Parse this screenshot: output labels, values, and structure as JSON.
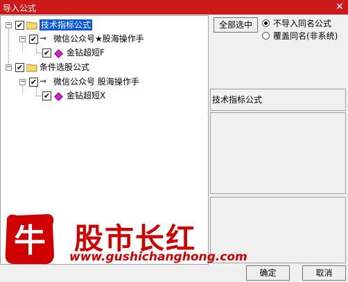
{
  "window": {
    "title": "导入公式",
    "close_symbol": "✕"
  },
  "tree": {
    "nodes": [
      {
        "label": "技术指标公式",
        "checked": true,
        "type": "folder",
        "selected": true
      },
      {
        "label": "微信公众号★股海操作手",
        "checked": true,
        "type": "author"
      },
      {
        "label": "金钻超短F",
        "checked": true,
        "type": "formula"
      },
      {
        "label": "条件选股公式",
        "checked": true,
        "type": "folder"
      },
      {
        "label": "微信公众号 股海操作手",
        "checked": true,
        "type": "author"
      },
      {
        "label": "金钻超短X",
        "checked": true,
        "type": "formula"
      }
    ]
  },
  "controls": {
    "select_all_label": "全部选中",
    "options": [
      {
        "label": "不导入同名公式",
        "selected": true
      },
      {
        "label": "覆盖同名(非系统)",
        "selected": false
      }
    ],
    "info_text": "技术指标公式"
  },
  "buttons": {
    "ok_label": "确定",
    "cancel_label": "取消"
  },
  "watermark": {
    "logo_char": "牛",
    "brand_text": "股市长红",
    "url": "www.gushichanghong.com"
  },
  "colors": {
    "titlebar": "#cc1a1a",
    "selection": "#0a5ad8",
    "brand_red": "#d00000",
    "formula_gem": "#d020d0"
  }
}
